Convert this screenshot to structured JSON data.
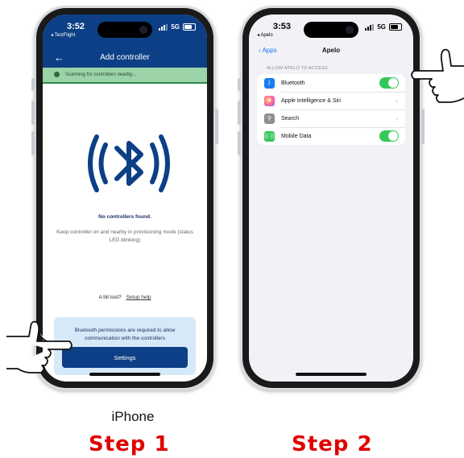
{
  "phone1": {
    "status_time": "3:52",
    "status_sub": "◂ TestFlight",
    "network": "5G",
    "title": "Add controller",
    "scanning_text": "Scanning for controllers nearby...",
    "no_controllers": "No controllers found.",
    "keep_text": "Keep controller on and nearby in provisioning mode (status LED blinking)",
    "lost_text": "A bit lost?",
    "setup_help": "Setup help",
    "permission_text": "Bluetooth permissions are required to allow communication with the controllers",
    "settings_label": "Settings",
    "brand_color": "#0d3f86",
    "scan_color": "#9bd2a8"
  },
  "phone2": {
    "status_time": "3:53",
    "status_sub": "◂ Apelo",
    "network": "5G",
    "back_label": "Apps",
    "title": "Apelo",
    "section_header": "ALLOW APELO TO ACCESS",
    "rows": [
      {
        "label": "Bluetooth",
        "icon": "bluetooth-icon",
        "control": "toggle",
        "state": "on"
      },
      {
        "label": "Apple Intelligence & Siri",
        "icon": "siri-icon",
        "control": "chevron"
      },
      {
        "label": "Search",
        "icon": "search-icon",
        "control": "chevron"
      },
      {
        "label": "Mobile Data",
        "icon": "antenna-icon",
        "control": "toggle",
        "state": "on"
      }
    ],
    "toggle_color": "#34c759"
  },
  "captions": {
    "device": "iPhone",
    "step1": "Step 1",
    "step2": "Step 2"
  }
}
